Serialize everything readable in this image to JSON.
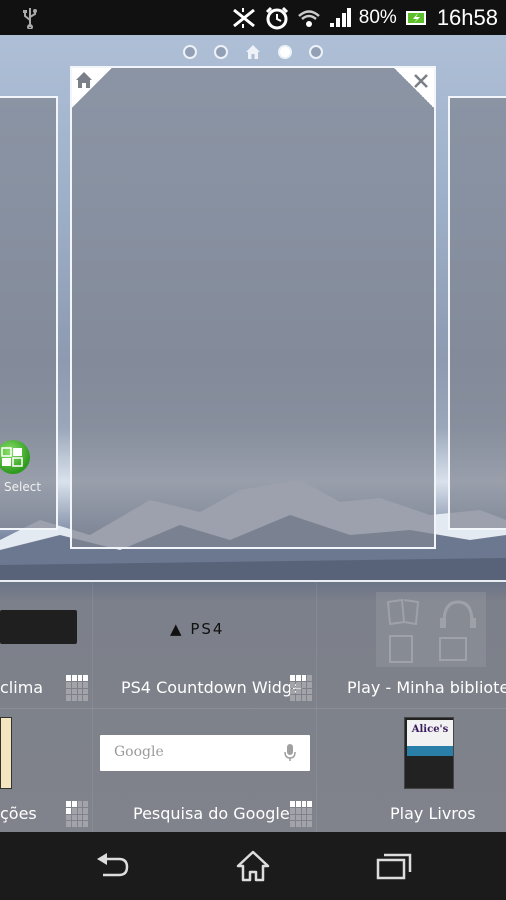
{
  "status_bar": {
    "battery_percent": "80%",
    "time": "16h58",
    "icons": [
      "usb-icon",
      "nfc-icon",
      "alarm-icon",
      "wifi-icon",
      "signal-icon",
      "battery-charging-icon"
    ]
  },
  "home": {
    "page_count": 5,
    "current_page": 4,
    "home_page": 3
  },
  "left_panel": {
    "app_label": "Select"
  },
  "widgets": [
    {
      "label": "clima",
      "size_icon": "widget-size-4x1"
    },
    {
      "label": "PS4 Countdown Widge",
      "preview_text": "PS4",
      "size_icon": "widget-size-3x1"
    },
    {
      "label": "Play - Minha biblioteca"
    },
    {
      "label": "ções",
      "size_icon": "widget-size-2x2"
    },
    {
      "label": "Pesquisa do Google",
      "preview_text": "Google",
      "size_icon": "widget-size-4x1"
    },
    {
      "label": "Play Livros",
      "preview_text": "Alice's"
    }
  ],
  "navbar": {
    "buttons": [
      "back",
      "home",
      "recent-apps"
    ]
  }
}
